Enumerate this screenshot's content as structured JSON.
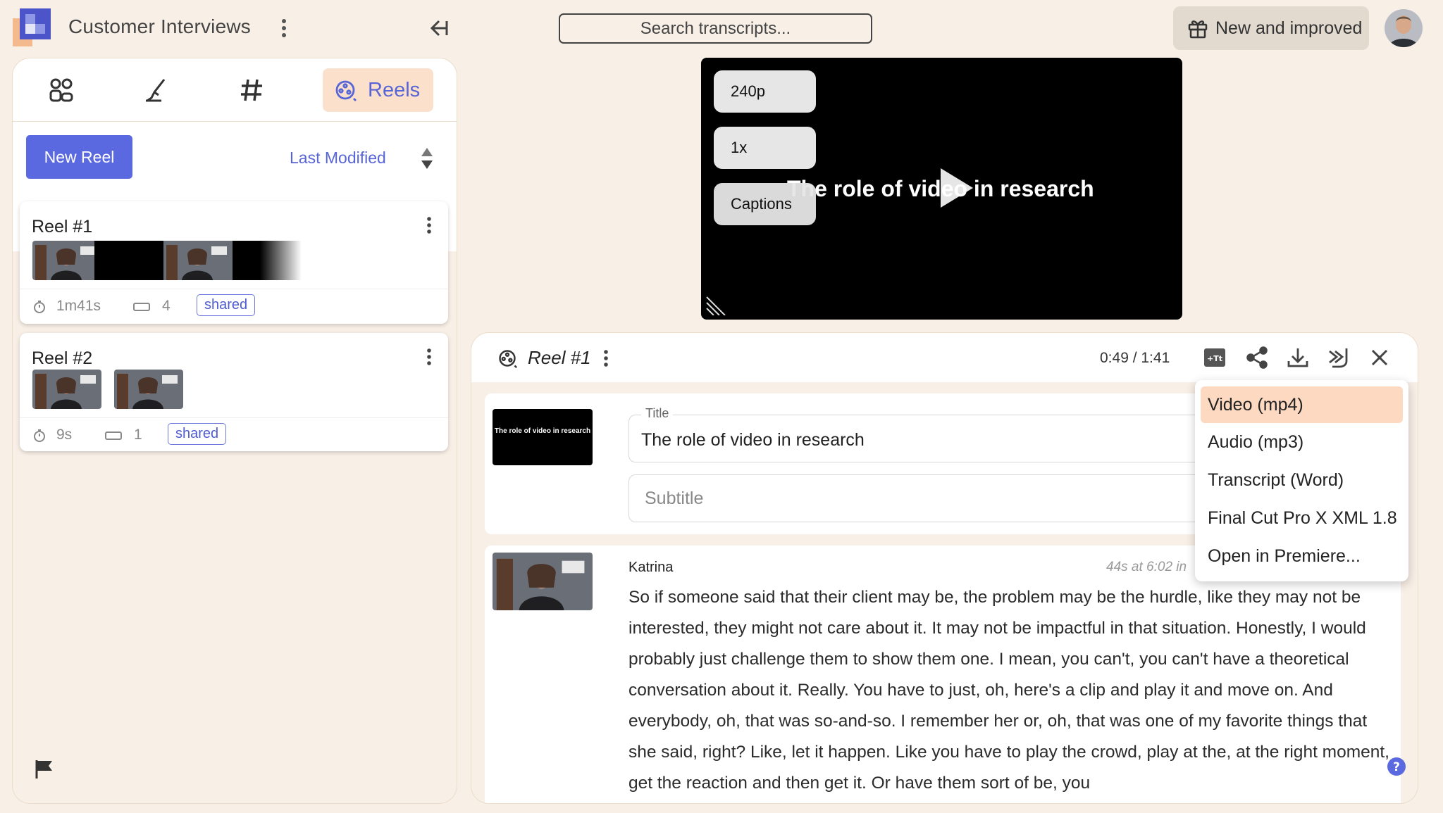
{
  "header": {
    "project_title": "Customer Interviews",
    "search_placeholder": "Search transcripts...",
    "new_and_improved": "New and improved"
  },
  "left_panel": {
    "tabs": [
      {
        "icon": "participants-icon"
      },
      {
        "icon": "highlighter-icon"
      },
      {
        "icon": "hashtag-icon"
      },
      {
        "icon": "reel-icon",
        "label": "Reels",
        "active": true
      }
    ],
    "new_reel_label": "New Reel",
    "sort_label": "Last Modified",
    "reels": [
      {
        "title": "Reel #1",
        "duration": "1m41s",
        "clip_count": "4",
        "badge": "shared"
      },
      {
        "title": "Reel #2",
        "duration": "9s",
        "clip_count": "1",
        "badge": "shared"
      }
    ]
  },
  "video": {
    "quality": "240p",
    "speed": "1x",
    "captions_label": "Captions",
    "overlay_text": "The role of video in research"
  },
  "editor": {
    "reel_title": "Reel #1",
    "timecode": "0:49 / 1:41",
    "title_legend": "Title",
    "title_value": "The role of video in research",
    "title_thumb_text": "The role of video in research",
    "subtitle_placeholder": "Subtitle",
    "clip": {
      "speaker": "Katrina",
      "meta": "44s at 6:02 in",
      "transcript": "So if someone said that their client may be, the problem may be the hurdle, like they may not be interested, they might not care about it. It may not be impactful in that situation. Honestly, I would probably just challenge them to show them one. I mean, you can't, you can't have a theoretical conversation about it. Really. You have to just, oh, here's a clip and play it and move on. And everybody, oh, that was so-and-so. I remember her or, oh, that was one of my favorite things that she said, right? Like, let it happen. Like you have to play the crowd, play at the, at the right moment, get the reaction and then get it. Or have them sort of be, you"
    }
  },
  "export_menu": {
    "items": [
      "Video (mp4)",
      "Audio (mp3)",
      "Transcript (Word)",
      "Final Cut Pro X XML 1.8",
      "Open in Premiere..."
    ],
    "selected": "Video (mp4)"
  },
  "colors": {
    "accent": "#5b69e0",
    "background": "#f8efe6",
    "highlight": "#fcd9c0"
  }
}
